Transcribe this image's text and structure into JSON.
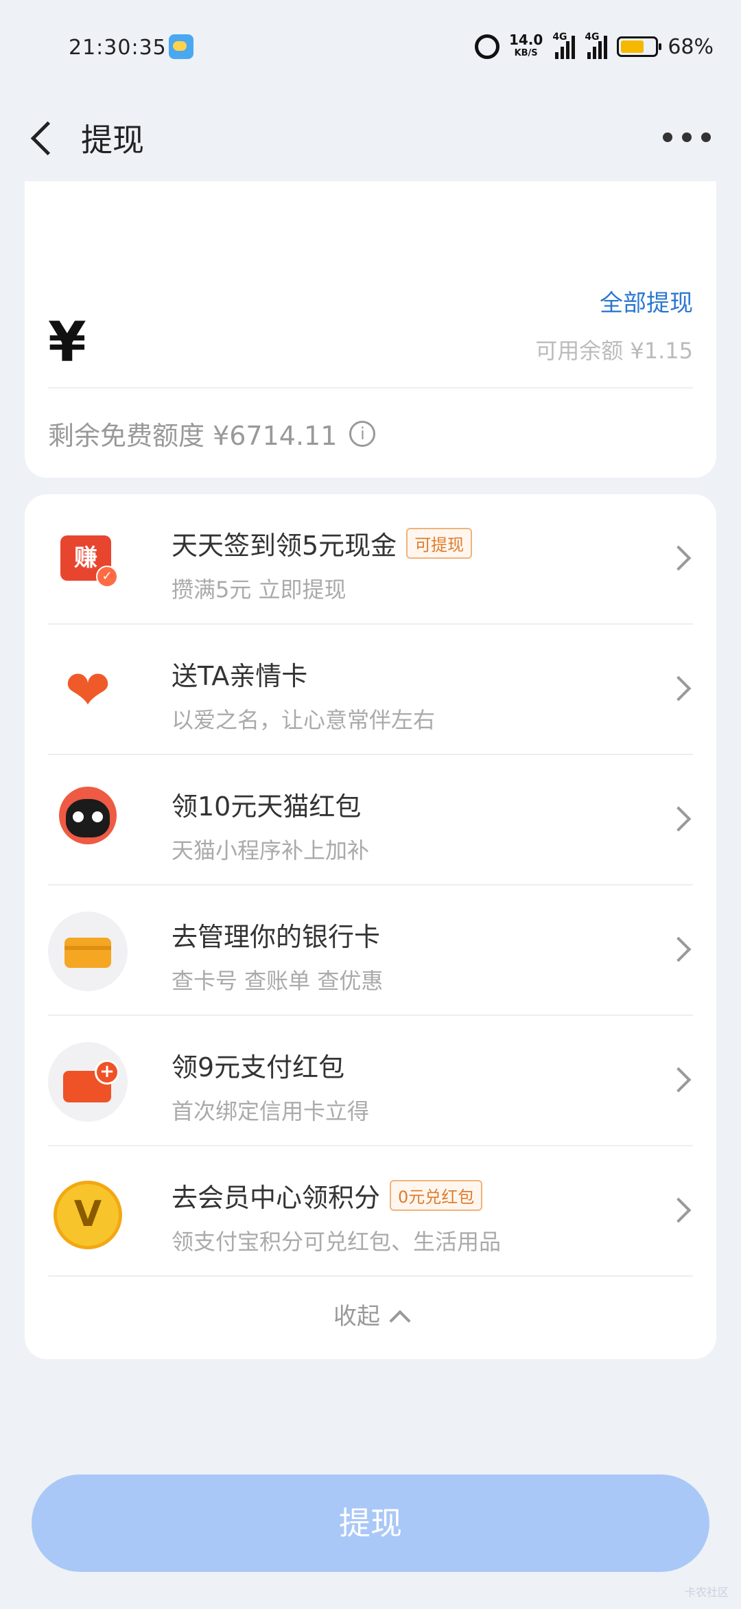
{
  "status": {
    "time": "21:30:35",
    "speed": "14.0",
    "speed_unit": "KB/S",
    "signal1": "4G",
    "signal2": "4G",
    "battery": "68%",
    "battery_level": 0.68
  },
  "nav": {
    "title": "提现"
  },
  "amount": {
    "withdraw_all": "全部提现",
    "currency": "¥",
    "available": "可用余额 ¥1.15",
    "free_quota": "剩余免费额度 ¥6714.11",
    "info_glyph": "i"
  },
  "list": {
    "items": [
      {
        "title": "天天签到领5元现金",
        "tag": "可提现",
        "subtitle": "攒满5元 立即提现",
        "icon": "earn-icon"
      },
      {
        "title": "送TA亲情卡",
        "subtitle": "以爱之名，让心意常伴左右",
        "icon": "heart-card-icon"
      },
      {
        "title": "领10元天猫红包",
        "subtitle": "天猫小程序补上加补",
        "icon": "tmall-cat-icon"
      },
      {
        "title": "去管理你的银行卡",
        "subtitle": "查卡号 查账单 查优惠",
        "icon": "bank-card-icon"
      },
      {
        "title": "领9元支付红包",
        "subtitle": "首次绑定信用卡立得",
        "icon": "credit-card-add-icon"
      },
      {
        "title": "去会员中心领积分",
        "tag": "0元兑红包",
        "subtitle": "领支付宝积分可兑红包、生活用品",
        "icon": "vip-icon"
      }
    ],
    "collapse": "收起"
  },
  "button": {
    "label": "提现"
  },
  "icons": {
    "heart": "❤",
    "earn": "赚",
    "vip": "V"
  },
  "watermark": "卡农社区"
}
